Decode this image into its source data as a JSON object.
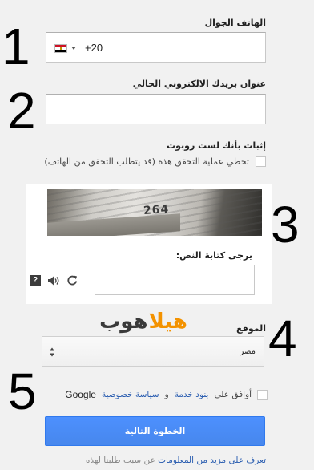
{
  "steps": [
    "1",
    "2",
    "3",
    "4",
    "5"
  ],
  "phone": {
    "label": "الهاتف الجوال",
    "country_code": "+20",
    "flag_icon": "egypt-flag-icon"
  },
  "email": {
    "label": "عنوان بريدك الالكتروني الحالي",
    "value": ""
  },
  "robot": {
    "label": "إثبات بأنك لست روبوت",
    "skip_text": "تخطي عملية التحقق هذه (قد يتطلب التحقق من الهاتف)"
  },
  "captcha": {
    "image_text": "264",
    "prompt": "يرجى كتابة النص:",
    "help_glyph": "?"
  },
  "watermark": {
    "part_a": "هيلا",
    "part_b": "هوب"
  },
  "location": {
    "label": "الموقع",
    "selected": "مصر"
  },
  "terms": {
    "prefix": "أوافق على",
    "tos_link": "بنود خدمة",
    "conjunction": "و",
    "privacy_link": "سياسة خصوصية",
    "brand": "Google"
  },
  "next_button": "الخطوة التالية",
  "footer": {
    "link": "تعرف على مزيد من المعلومات",
    "text": "عن سبب طلبنا لهذه"
  },
  "colors": {
    "button_blue": "#4d90fe",
    "link_blue": "#2a5db0",
    "watermark_orange": "#f39200"
  }
}
